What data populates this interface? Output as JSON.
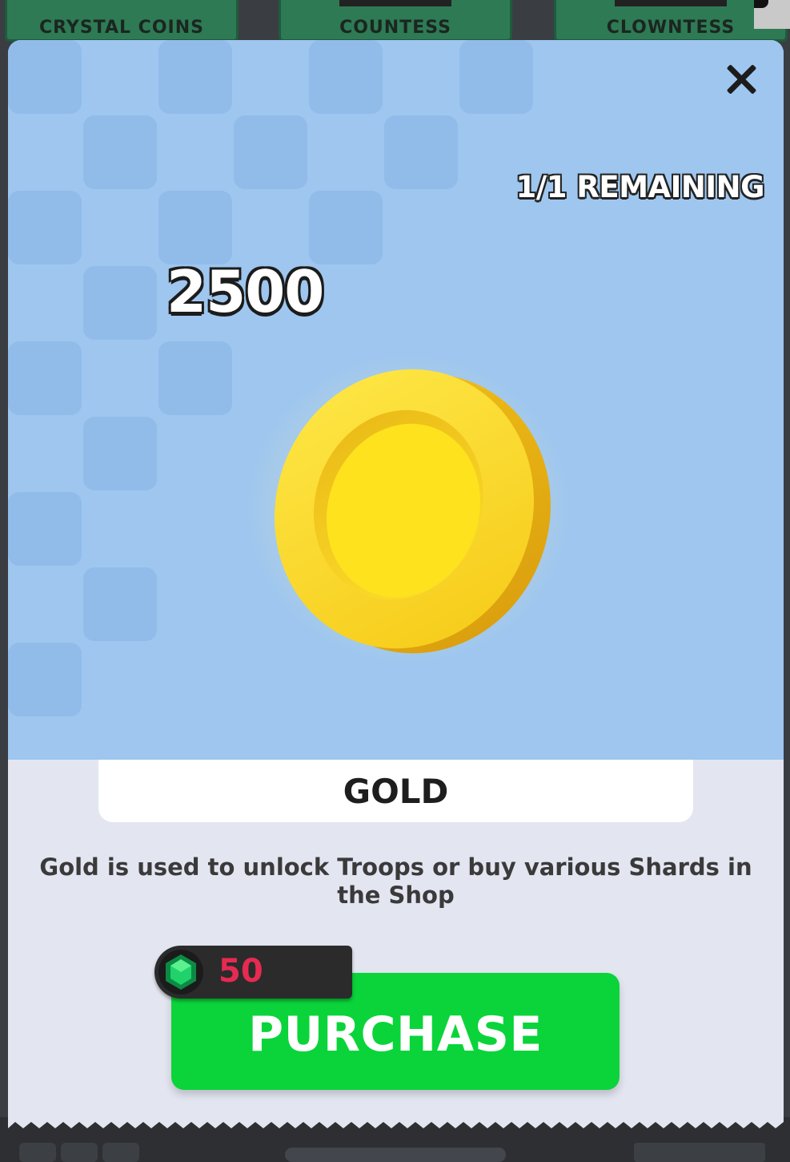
{
  "background_tabs": [
    {
      "label": "CRYSTAL COINS"
    },
    {
      "label": "COUNTESS"
    },
    {
      "label": "CLOWNTESS"
    }
  ],
  "offer": {
    "remaining": "1/1 REMAINING",
    "amount": "2500",
    "item_icon": "gold-coin-icon",
    "name": "GOLD",
    "description": "Gold is used to unlock Troops or buy various Shards in the Shop"
  },
  "purchase": {
    "label": "PURCHASE",
    "price": "50",
    "currency_icon": "gem-icon"
  },
  "colors": {
    "hero_bg": "#9ec6ef",
    "purchase_green": "#0ad43a",
    "price_red": "#e62a52",
    "coin_gold": "#f7d21c"
  }
}
